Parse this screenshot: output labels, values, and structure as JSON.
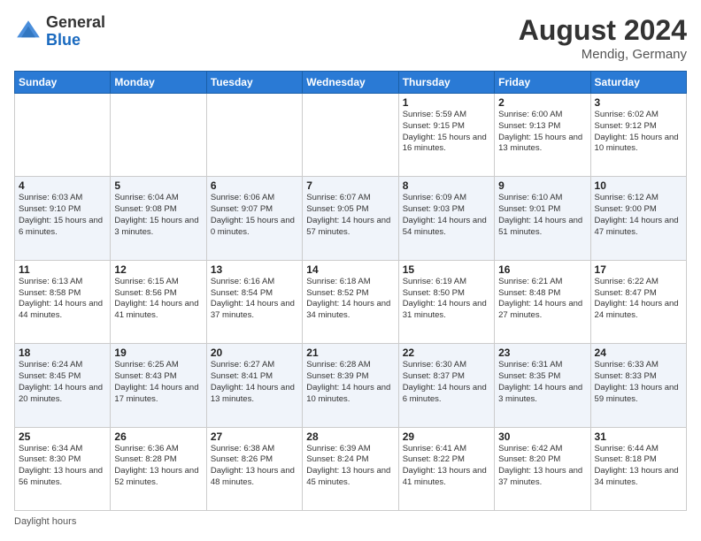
{
  "header": {
    "logo_general": "General",
    "logo_blue": "Blue",
    "month_year": "August 2024",
    "location": "Mendig, Germany"
  },
  "days_of_week": [
    "Sunday",
    "Monday",
    "Tuesday",
    "Wednesday",
    "Thursday",
    "Friday",
    "Saturday"
  ],
  "weeks": [
    [
      {
        "day": "",
        "info": ""
      },
      {
        "day": "",
        "info": ""
      },
      {
        "day": "",
        "info": ""
      },
      {
        "day": "",
        "info": ""
      },
      {
        "day": "1",
        "info": "Sunrise: 5:59 AM\nSunset: 9:15 PM\nDaylight: 15 hours and 16 minutes."
      },
      {
        "day": "2",
        "info": "Sunrise: 6:00 AM\nSunset: 9:13 PM\nDaylight: 15 hours and 13 minutes."
      },
      {
        "day": "3",
        "info": "Sunrise: 6:02 AM\nSunset: 9:12 PM\nDaylight: 15 hours and 10 minutes."
      }
    ],
    [
      {
        "day": "4",
        "info": "Sunrise: 6:03 AM\nSunset: 9:10 PM\nDaylight: 15 hours and 6 minutes."
      },
      {
        "day": "5",
        "info": "Sunrise: 6:04 AM\nSunset: 9:08 PM\nDaylight: 15 hours and 3 minutes."
      },
      {
        "day": "6",
        "info": "Sunrise: 6:06 AM\nSunset: 9:07 PM\nDaylight: 15 hours and 0 minutes."
      },
      {
        "day": "7",
        "info": "Sunrise: 6:07 AM\nSunset: 9:05 PM\nDaylight: 14 hours and 57 minutes."
      },
      {
        "day": "8",
        "info": "Sunrise: 6:09 AM\nSunset: 9:03 PM\nDaylight: 14 hours and 54 minutes."
      },
      {
        "day": "9",
        "info": "Sunrise: 6:10 AM\nSunset: 9:01 PM\nDaylight: 14 hours and 51 minutes."
      },
      {
        "day": "10",
        "info": "Sunrise: 6:12 AM\nSunset: 9:00 PM\nDaylight: 14 hours and 47 minutes."
      }
    ],
    [
      {
        "day": "11",
        "info": "Sunrise: 6:13 AM\nSunset: 8:58 PM\nDaylight: 14 hours and 44 minutes."
      },
      {
        "day": "12",
        "info": "Sunrise: 6:15 AM\nSunset: 8:56 PM\nDaylight: 14 hours and 41 minutes."
      },
      {
        "day": "13",
        "info": "Sunrise: 6:16 AM\nSunset: 8:54 PM\nDaylight: 14 hours and 37 minutes."
      },
      {
        "day": "14",
        "info": "Sunrise: 6:18 AM\nSunset: 8:52 PM\nDaylight: 14 hours and 34 minutes."
      },
      {
        "day": "15",
        "info": "Sunrise: 6:19 AM\nSunset: 8:50 PM\nDaylight: 14 hours and 31 minutes."
      },
      {
        "day": "16",
        "info": "Sunrise: 6:21 AM\nSunset: 8:48 PM\nDaylight: 14 hours and 27 minutes."
      },
      {
        "day": "17",
        "info": "Sunrise: 6:22 AM\nSunset: 8:47 PM\nDaylight: 14 hours and 24 minutes."
      }
    ],
    [
      {
        "day": "18",
        "info": "Sunrise: 6:24 AM\nSunset: 8:45 PM\nDaylight: 14 hours and 20 minutes."
      },
      {
        "day": "19",
        "info": "Sunrise: 6:25 AM\nSunset: 8:43 PM\nDaylight: 14 hours and 17 minutes."
      },
      {
        "day": "20",
        "info": "Sunrise: 6:27 AM\nSunset: 8:41 PM\nDaylight: 14 hours and 13 minutes."
      },
      {
        "day": "21",
        "info": "Sunrise: 6:28 AM\nSunset: 8:39 PM\nDaylight: 14 hours and 10 minutes."
      },
      {
        "day": "22",
        "info": "Sunrise: 6:30 AM\nSunset: 8:37 PM\nDaylight: 14 hours and 6 minutes."
      },
      {
        "day": "23",
        "info": "Sunrise: 6:31 AM\nSunset: 8:35 PM\nDaylight: 14 hours and 3 minutes."
      },
      {
        "day": "24",
        "info": "Sunrise: 6:33 AM\nSunset: 8:33 PM\nDaylight: 13 hours and 59 minutes."
      }
    ],
    [
      {
        "day": "25",
        "info": "Sunrise: 6:34 AM\nSunset: 8:30 PM\nDaylight: 13 hours and 56 minutes."
      },
      {
        "day": "26",
        "info": "Sunrise: 6:36 AM\nSunset: 8:28 PM\nDaylight: 13 hours and 52 minutes."
      },
      {
        "day": "27",
        "info": "Sunrise: 6:38 AM\nSunset: 8:26 PM\nDaylight: 13 hours and 48 minutes."
      },
      {
        "day": "28",
        "info": "Sunrise: 6:39 AM\nSunset: 8:24 PM\nDaylight: 13 hours and 45 minutes."
      },
      {
        "day": "29",
        "info": "Sunrise: 6:41 AM\nSunset: 8:22 PM\nDaylight: 13 hours and 41 minutes."
      },
      {
        "day": "30",
        "info": "Sunrise: 6:42 AM\nSunset: 8:20 PM\nDaylight: 13 hours and 37 minutes."
      },
      {
        "day": "31",
        "info": "Sunrise: 6:44 AM\nSunset: 8:18 PM\nDaylight: 13 hours and 34 minutes."
      }
    ]
  ],
  "footer": {
    "daylight_label": "Daylight hours"
  }
}
